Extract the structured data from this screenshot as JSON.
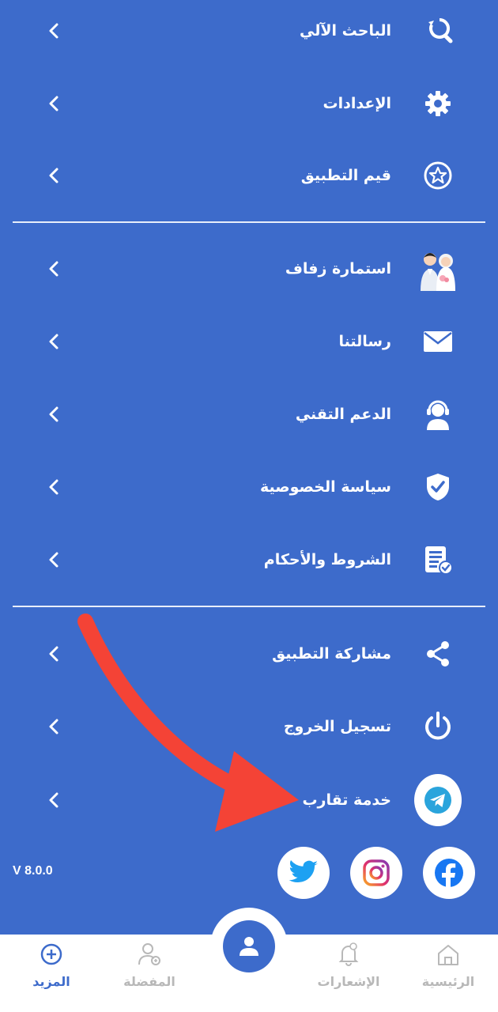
{
  "menu": {
    "items": [
      {
        "label": "الباحث الآلي",
        "icon": "search-refresh-icon"
      },
      {
        "label": "الإعدادات",
        "icon": "gear-icon"
      },
      {
        "label": "قيم التطبيق",
        "icon": "star-circle-icon"
      },
      {
        "label": "استمارة زفاف",
        "icon": "wedding-couple-icon"
      },
      {
        "label": "رسالتنا",
        "icon": "mail-icon"
      },
      {
        "label": "الدعم التقني",
        "icon": "headset-support-icon"
      },
      {
        "label": "سياسة الخصوصية",
        "icon": "shield-check-icon"
      },
      {
        "label": "الشروط والأحكام",
        "icon": "document-check-icon"
      },
      {
        "label": "مشاركة التطبيق",
        "icon": "share-icon"
      },
      {
        "label": "تسجيل الخروج",
        "icon": "power-icon"
      },
      {
        "label": "خدمة تقارب",
        "icon": "telegram-icon"
      }
    ]
  },
  "version": "V 8.0.0",
  "social": [
    "twitter-icon",
    "instagram-icon",
    "facebook-icon"
  ],
  "bottom_nav": {
    "items": [
      {
        "label": "المزيد",
        "icon": "plus-circle-icon",
        "active": true
      },
      {
        "label": "المفضلة",
        "icon": "user-heart-icon",
        "active": false
      },
      {
        "label": "الإشعارات",
        "icon": "bell-icon",
        "active": false
      },
      {
        "label": "الرئيسية",
        "icon": "home-icon",
        "active": false
      }
    ],
    "center": "profile-icon"
  },
  "colors": {
    "background": "#3d6bcb",
    "text": "#ffffff",
    "annotation_arrow": "#f44336",
    "nav_active": "#3d6bcb",
    "nav_inactive": "#b8b8b8"
  }
}
